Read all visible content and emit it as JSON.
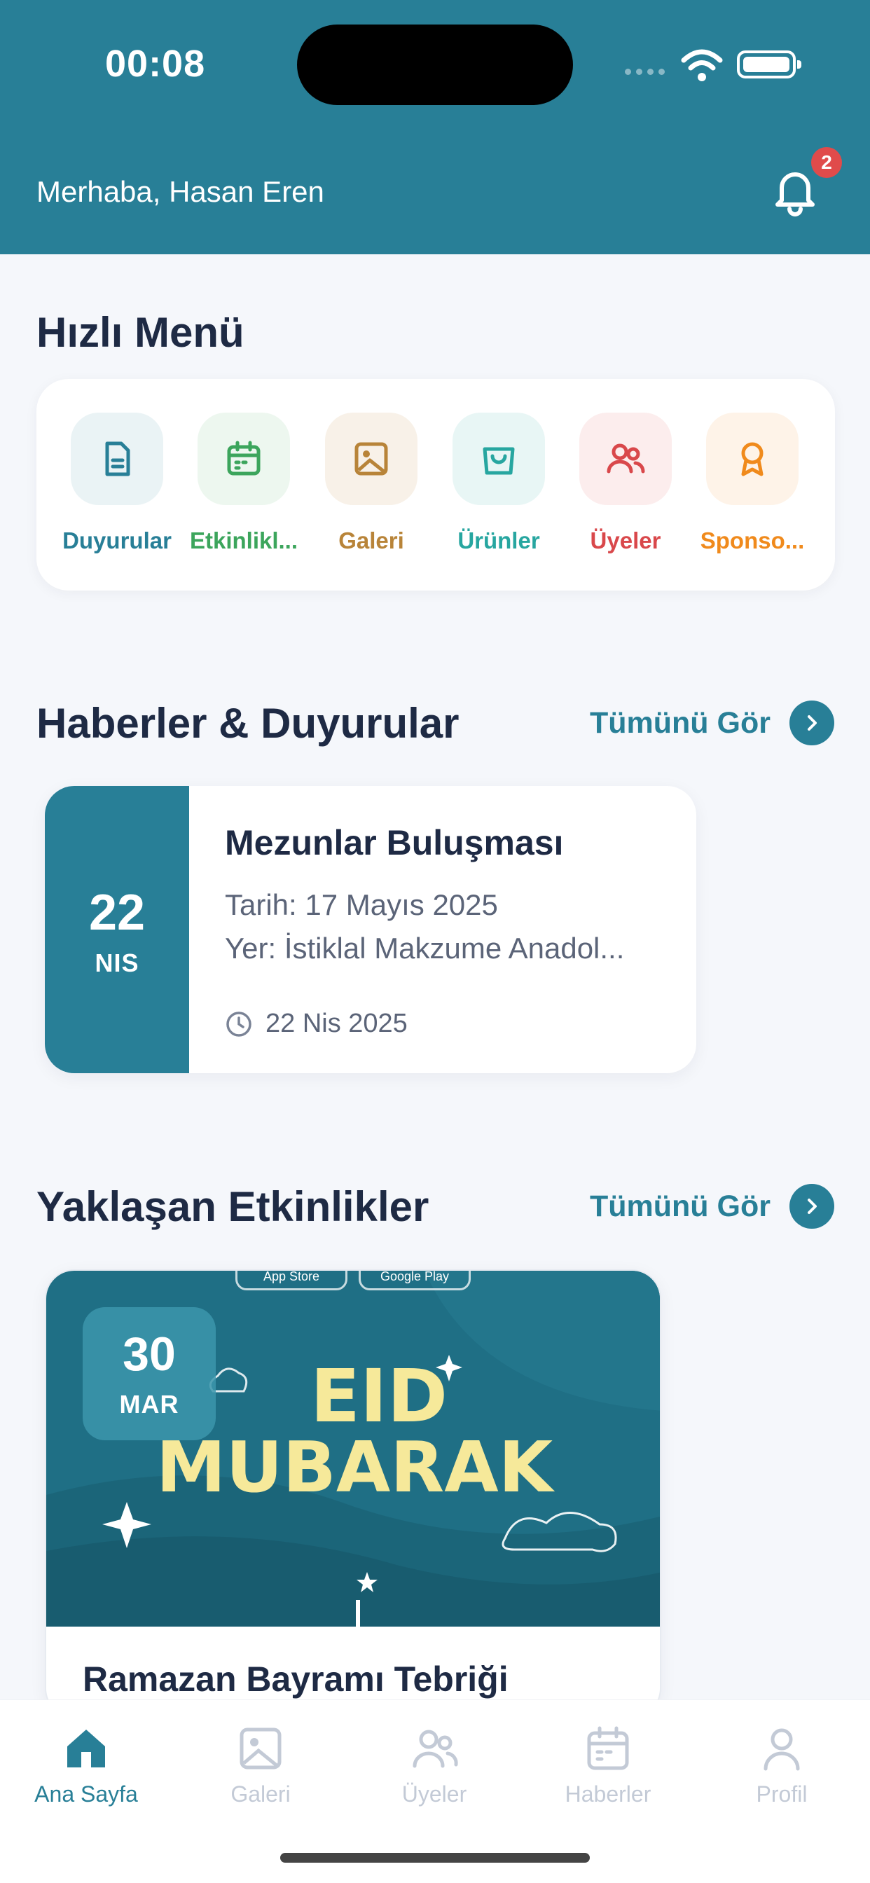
{
  "status_bar": {
    "time": "00:08"
  },
  "header": {
    "greeting": "Merhaba, Hasan Eren",
    "notification_count": "2"
  },
  "quick_menu": {
    "title": "Hızlı Menü",
    "items": [
      {
        "label": "Duyurular",
        "icon": "document-icon",
        "color": "#287F97",
        "bg": "#EAF3F5"
      },
      {
        "label": "Etkinlikl...",
        "icon": "calendar-icon",
        "color": "#3CA55C",
        "bg": "#EDF7EF"
      },
      {
        "label": "Galeri",
        "icon": "image-icon",
        "color": "#B88439",
        "bg": "#F8F1E8"
      },
      {
        "label": "Ürünler",
        "icon": "shopping-bag-icon",
        "color": "#27A6A0",
        "bg": "#E8F6F5"
      },
      {
        "label": "Üyeler",
        "icon": "users-icon",
        "color": "#D9484B",
        "bg": "#FCEDED"
      },
      {
        "label": "Sponso...",
        "icon": "award-icon",
        "color": "#F08A1C",
        "bg": "#FEF3E8"
      }
    ]
  },
  "news": {
    "title": "Haberler & Duyurular",
    "see_all": "Tümünü Gör",
    "card": {
      "day": "22",
      "month": "NIS",
      "headline": "Mezunlar Buluşması",
      "line1": "Tarih: 17 Mayıs 2025",
      "line2": "Yer: İstiklal Makzume Anadol...",
      "posted": "22 Nis 2025"
    }
  },
  "events": {
    "title": "Yaklaşan Etkinlikler",
    "see_all": "Tümünü Gör",
    "card": {
      "day": "30",
      "month": "MAR",
      "image_text_line1": "EID",
      "image_text_line2": "MUBARAK",
      "store_badge_1": "App Store",
      "store_badge_2": "Google Play",
      "headline": "Ramazan Bayramı Tebriği"
    }
  },
  "tabbar": {
    "active_color": "#287F97",
    "inactive_color": "#C3CAD6",
    "items": [
      {
        "label": "Ana Sayfa",
        "icon": "home-icon",
        "active": true
      },
      {
        "label": "Galeri",
        "icon": "image-icon",
        "active": false
      },
      {
        "label": "Üyeler",
        "icon": "users-icon",
        "active": false
      },
      {
        "label": "Haberler",
        "icon": "calendar-icon",
        "active": false
      },
      {
        "label": "Profil",
        "icon": "user-icon",
        "active": false
      }
    ]
  }
}
